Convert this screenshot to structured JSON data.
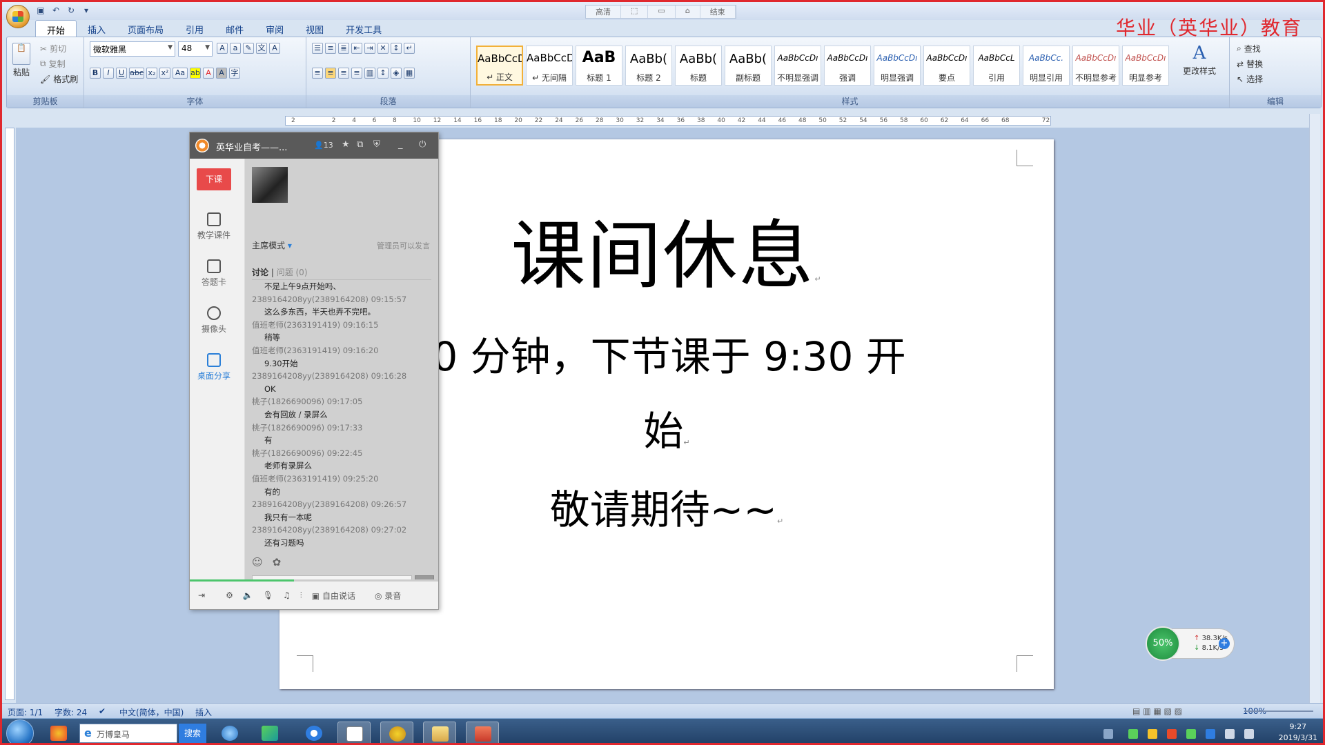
{
  "window": {
    "quick_access": [
      "save-icon",
      "undo-icon",
      "redo-icon"
    ],
    "context_tabs": [
      "高清",
      "",
      "",
      "",
      "结束"
    ],
    "brand": "华业（英华业）教育"
  },
  "tabs": [
    "开始",
    "插入",
    "页面布局",
    "引用",
    "邮件",
    "审阅",
    "视图",
    "开发工具"
  ],
  "ribbon": {
    "clipboard": {
      "paste": "粘贴",
      "cut": "剪切",
      "copy": "复制",
      "format_painter": "格式刷",
      "label": "剪贴板"
    },
    "font": {
      "name": "微软雅黑",
      "size": "48",
      "label": "字体"
    },
    "paragraph": {
      "label": "段落"
    },
    "styles": {
      "label": "样式",
      "items": [
        {
          "preview": "AaBbCcD",
          "name": "↵ 正文"
        },
        {
          "preview": "AaBbCcD",
          "name": "↵ 无间隔"
        },
        {
          "preview": "AaB",
          "name": "标题 1"
        },
        {
          "preview": "AaBb(",
          "name": "标题 2"
        },
        {
          "preview": "AaBb(",
          "name": "标题"
        },
        {
          "preview": "AaBb(",
          "name": "副标题"
        },
        {
          "preview": "AaBbCcDı",
          "name": "不明显强调"
        },
        {
          "preview": "AaBbCcDı",
          "name": "强调"
        },
        {
          "preview": "AaBbCcDı",
          "name": "明显强调"
        },
        {
          "preview": "AaBbCcDı",
          "name": "要点"
        },
        {
          "preview": "AaBbCcL",
          "name": "引用"
        },
        {
          "preview": "AaBbCc.",
          "name": "明显引用"
        },
        {
          "preview": "AaBbCcDı",
          "name": "不明显参考"
        },
        {
          "preview": "AaBbCcDı",
          "name": "明显参考"
        }
      ],
      "change_styles": "更改样式"
    },
    "editing": {
      "find": "查找",
      "replace": "替换",
      "select": "选择",
      "label": "编辑"
    }
  },
  "ruler_ticks": [
    "2",
    "",
    "2",
    "4",
    "6",
    "8",
    "10",
    "12",
    "14",
    "16",
    "18",
    "20",
    "22",
    "24",
    "26",
    "28",
    "30",
    "32",
    "34",
    "36",
    "38",
    "40",
    "42",
    "44",
    "46",
    "48",
    "50",
    "52",
    "54",
    "56",
    "58",
    "60",
    "62",
    "64",
    "66",
    "68",
    "",
    "72"
  ],
  "document": {
    "title": "课间休息",
    "line2": "休息 10 分钟，下节课于 9:30 开",
    "line3": "始",
    "line4": "敬请期待~~"
  },
  "chat": {
    "title": "英华业自考——...",
    "member_count": "13",
    "end_class": "下课",
    "side": [
      "教学课件",
      "答题卡",
      "摄像头",
      "桌面分享"
    ],
    "mode": "主席模式",
    "mode_note": "管理员可以发言",
    "tab_discussion": "讨论",
    "tab_question": "问题 (0)",
    "messages": [
      {
        "meta": "2389164208yy(2389164208) 09:15:57",
        "text": "不是上午9点开始吗、"
      },
      {
        "meta": "2389164208yy(2389164208) 09:15:57",
        "text": "这么多东西，半天也弄不完吧。"
      },
      {
        "meta": "值班老师(2363191419) 09:16:15",
        "text": "稍等"
      },
      {
        "meta": "值班老师(2363191419) 09:16:20",
        "text": "9.30开始"
      },
      {
        "meta": "2389164208yy(2389164208) 09:16:28",
        "text": "OK"
      },
      {
        "meta": "桃子(1826690096) 09:17:05",
        "text": "会有回放 / 录屏么"
      },
      {
        "meta": "桃子(1826690096) 09:17:33",
        "text": "有"
      },
      {
        "meta": "桃子(1826690096) 09:22:45",
        "text": "老师有录屏么"
      },
      {
        "meta": "值班老师(2363191419) 09:25:20",
        "text": "有的"
      },
      {
        "meta": "2389164208yy(2389164208) 09:26:57",
        "text": "我只有一本呢"
      },
      {
        "meta": "2389164208yy(2389164208) 09:27:02",
        "text": "还有习题吗"
      }
    ],
    "footer_free_talk": "自由说话",
    "footer_record": "录音",
    "progress": 0.42
  },
  "net_widget": {
    "percent": "50%",
    "up": "38.3K/s",
    "down": "8.1K/s"
  },
  "status": {
    "page": "页面: 1/1",
    "words": "字数: 24",
    "lang": "中文(简体，中国)",
    "mode": "插入",
    "zoom": "100%"
  },
  "taskbar": {
    "search_placeholder": "万博皇马",
    "search_btn": "搜索",
    "time": "9:27",
    "date": "2019/3/31"
  }
}
